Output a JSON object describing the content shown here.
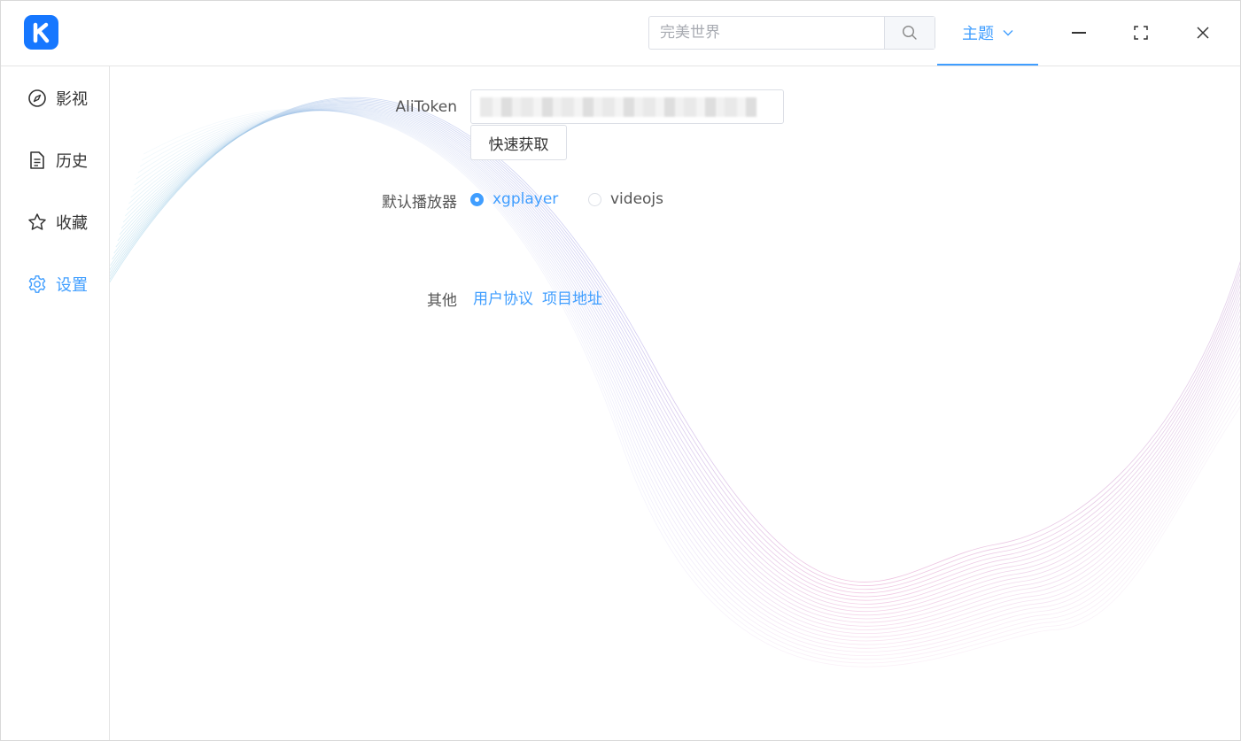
{
  "app": {
    "logo_letter": "K",
    "brand_color": "#1677ff",
    "accent_color": "#409eff"
  },
  "header": {
    "search_placeholder": "完美世界",
    "search_icon": "search-icon",
    "theme_label": "主题",
    "theme_icon": "chevron-down-icon",
    "window_controls": [
      "minimize-icon",
      "maximize-icon",
      "close-icon"
    ]
  },
  "sidebar": {
    "items": [
      {
        "label": "影视",
        "icon": "compass-icon",
        "active": false
      },
      {
        "label": "历史",
        "icon": "document-icon",
        "active": false
      },
      {
        "label": "收藏",
        "icon": "star-icon",
        "active": false
      },
      {
        "label": "设置",
        "icon": "gear-icon",
        "active": true
      }
    ]
  },
  "settings": {
    "alitoken_label": "AliToken",
    "alitoken_value_obscured": true,
    "quick_fetch_label": "快速获取",
    "player_label": "默认播放器",
    "player_options": [
      {
        "label": "xgplayer",
        "checked": true
      },
      {
        "label": "videojs",
        "checked": false
      }
    ],
    "other_label": "其他",
    "links": [
      "用户协议",
      "项目地址"
    ]
  }
}
